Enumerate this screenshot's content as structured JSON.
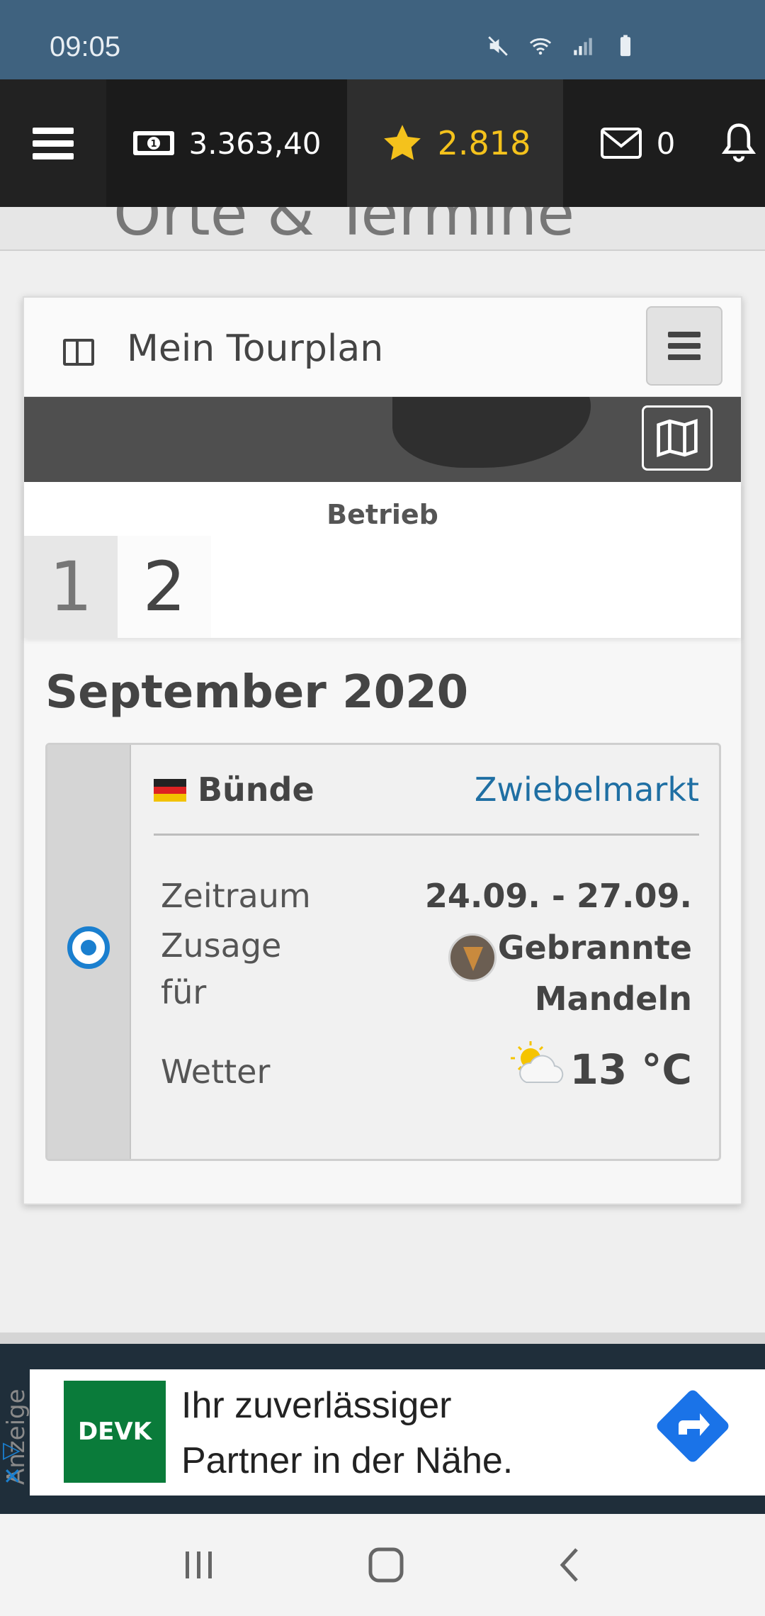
{
  "status": {
    "time": "09:05"
  },
  "topbar": {
    "money": "3.363,40",
    "stars": "2.818",
    "mail_count": "0"
  },
  "hero": {
    "ghost_text": "Orte & Termine"
  },
  "tourplan": {
    "title": "Mein Tourplan",
    "betrieb_label": "Betrieb",
    "tabs": [
      "1",
      "2"
    ],
    "month": "September 2020",
    "event": {
      "city": "Bünde",
      "market": "Zwiebelmarkt",
      "zeitraum_label": "Zeitraum",
      "zeitraum_value": "24.09. - 27.09.",
      "zusage_label": "Zusage für",
      "zusage_value": "Gebrannte Mandeln",
      "wetter_label": "Wetter",
      "wetter_value": "13 °C"
    }
  },
  "ad": {
    "side_label": "Anzeige",
    "logo": "DEVK",
    "text_line1": "Ihr zuverlässiger",
    "text_line2": "Partner in der Nähe."
  },
  "colors": {
    "statusbar": "#3f627f",
    "appbar": "#2a2a2a",
    "star": "#f4c21c",
    "link": "#1f6fa3",
    "radio": "#1a7fcf",
    "devk_green": "#0a7b3a"
  }
}
